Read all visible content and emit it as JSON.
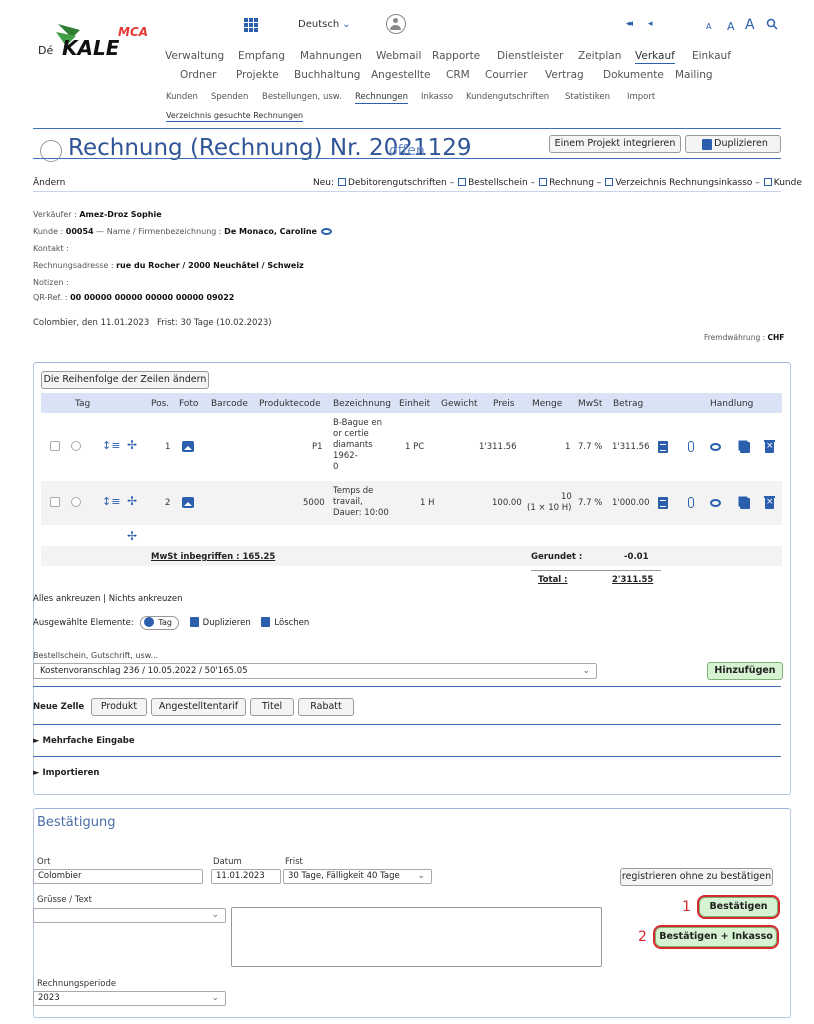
{
  "header": {
    "logo_text": "DéMOKALE",
    "logo_badge": "MCA",
    "language": "Deutsch",
    "nav_prev_all": "◂◂",
    "nav_prev": "◂",
    "font_sizes": [
      "A",
      "A",
      "A"
    ],
    "menu_row1": [
      "Verwaltung",
      "Empfang",
      "Mahnungen",
      "Webmail",
      "Rapporte",
      "Dienstleister",
      "Zeitplan",
      "Verkauf",
      "Einkauf"
    ],
    "menu_row2": [
      "Ordner",
      "Projekte",
      "Buchhaltung",
      "Angestellte",
      "CRM",
      "Courrier",
      "Vertrag",
      "Dokumente",
      "Mailing"
    ],
    "menu_row3": [
      "Kunden",
      "Spenden",
      "Bestellungen, usw.",
      "Rechnungen",
      "Inkasso",
      "Kundengutschriften",
      "Statistiken",
      "Import"
    ],
    "submenu": "Verzeichnis gesuchte Rechnungen"
  },
  "title": {
    "text": "Rechnung (Rechnung) Nr. 2021129",
    "status": "offen",
    "btn_integrate": "Einem Projekt integrieren",
    "btn_duplicate": "Duplizieren"
  },
  "action_bar": {
    "aendern": "Ändern",
    "neu_label": "Neu:",
    "neu_links": [
      "Debitorengutschriften",
      "Bestellschein",
      "Rechnung",
      "Verzeichnis Rechnungsinkasso",
      "Kunde"
    ]
  },
  "info": {
    "verkaeufer_label": "Verkäufer :",
    "verkaeufer": "Amez-Droz Sophie",
    "kunde_label": "Kunde :",
    "kunde": "00054",
    "name_label": "— Name / Firmenbezeichnung :",
    "name": "De Monaco, Caroline",
    "kontakt_label": "Kontakt :",
    "adresse_label": "Rechnungsadresse :",
    "adresse": "rue du Rocher / 2000 Neuchâtel / Schweiz",
    "notizen_label": "Notizen :",
    "qr_label": "QR-Ref. :",
    "qr": "00 00000 00000 00000 00000 09022",
    "ort_datum": "Colombier, den 11.01.2023",
    "frist": "Frist: 30 Tage (10.02.2023)",
    "fremd_label": "Fremdwährung :",
    "fremd": "CHF"
  },
  "table": {
    "btn_reorder": "Die Reihenfolge der Zeilen ändern",
    "headers": {
      "tag": "Tag",
      "pos": "Pos.",
      "foto": "Foto",
      "barcode": "Barcode",
      "produktcode": "Produktecode",
      "bezeichnung": "Bezeichnung",
      "einheit": "Einheit",
      "gewicht": "Gewicht",
      "preis": "Preis",
      "menge": "Menge",
      "mwst": "MwSt",
      "betrag": "Betrag",
      "handlung": "Handlung"
    },
    "rows": [
      {
        "pos": "1",
        "produktcode": "P1",
        "bez1": "B-Bague en",
        "bez2": "or certie",
        "bez3": "diamants",
        "bez4": "1962-",
        "bez5": "0",
        "einheit": "1 PC",
        "preis": "1'311.56",
        "menge": "1",
        "menge_sub": "",
        "mwst": "7.7 %",
        "betrag": "1'311.56"
      },
      {
        "pos": "2",
        "produktcode": "5000",
        "bez1": "Temps de",
        "bez2": "travail,",
        "bez3": "Dauer: 10:00",
        "bez4": "",
        "bez5": "",
        "einheit": "1 H",
        "preis": "100.00",
        "menge": "10",
        "menge_sub": "(1 × 10 H)",
        "mwst": "7.7 %",
        "betrag": "1'000.00"
      }
    ],
    "mwst_inbegriffen": "MwSt inbegriffen : 165.25",
    "gerundet_label": "Gerundet :",
    "gerundet": "-0.01",
    "total_label": "Total :",
    "total": "2'311.55"
  },
  "selection": {
    "alles": "Alles ankreuzen",
    "sep": "|",
    "nichts": "Nichts ankreuzen",
    "ausgewaehlt": "Ausgewählte Elemente:",
    "tag": "Tag",
    "duplizieren": "Duplizieren",
    "loeschen": "Löschen"
  },
  "bestellschein": {
    "label": "Bestellschein, Gutschrift, usw...",
    "value": "Kostenvoranschlag 236 / 10.05.2022 / 50'165.05",
    "btn_add": "Hinzufügen"
  },
  "neue_zelle": {
    "label": "Neue Zelle",
    "buttons": [
      "Produkt",
      "Angestelltentarif",
      "Titel",
      "Rabatt"
    ]
  },
  "sections": {
    "mehrfache": "► Mehrfache Eingabe",
    "importieren": "► Importieren"
  },
  "confirmation": {
    "title": "Bestätigung",
    "ort_label": "Ort",
    "ort": "Colombier",
    "datum_label": "Datum",
    "datum": "11.01.2023",
    "frist_label": "Frist",
    "frist": "30 Tage, Fälligkeit 40 Tage",
    "btn_register": "registrieren ohne zu bestätigen",
    "gruesse_label": "Grüsse / Text",
    "gruesse": "",
    "btn_confirm": "Bestätigen",
    "btn_confirm_inkasso": "Bestätigen + Inkasso",
    "annot1": "1",
    "annot2": "2",
    "periode_label": "Rechnungsperiode",
    "periode": "2023"
  },
  "colors": {
    "accent": "#2b5fae",
    "title": "#2f5596",
    "confirm_green": "#d6f2d2",
    "annotation_red": "#d9272e"
  }
}
